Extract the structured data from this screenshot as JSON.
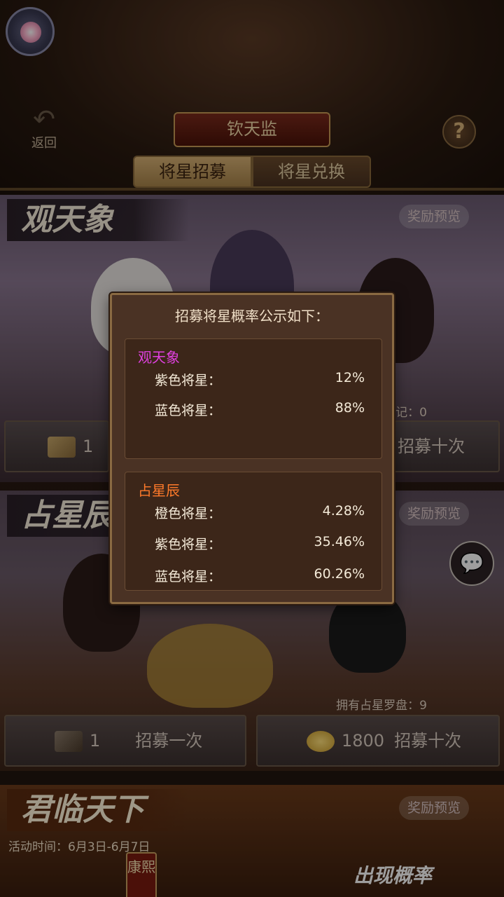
{
  "header": {
    "back_label": "返回",
    "title": "钦天监",
    "help_symbol": "?"
  },
  "tabs": [
    {
      "label": "将星招募",
      "active": true
    },
    {
      "label": "将星兑换",
      "active": false
    }
  ],
  "banners": [
    {
      "title": "观天象",
      "preview_label": "奖励预览",
      "record_note": "记：0",
      "single_cost": "1",
      "ten_label": "招募十次"
    },
    {
      "title": "占星辰",
      "preview_label": "奖励预览",
      "owned_note": "拥有占星罗盘：9",
      "single_cost": "1",
      "single_label": "招募一次",
      "ten_cost": "1800",
      "ten_label": "招募十次"
    },
    {
      "title": "君临天下",
      "preview_label": "奖励预览",
      "event_time": "活动时间：6月3日-6月7日",
      "hero_tag": "康熙",
      "prob_tag": "出现概率"
    }
  ],
  "dialog": {
    "title": "招募将星概率公示如下：",
    "groups": [
      {
        "name": "观天象",
        "color": "#e040e0",
        "rows": [
          {
            "label": "紫色将星：",
            "value": "12%"
          },
          {
            "label": "蓝色将星：",
            "value": "88%"
          }
        ]
      },
      {
        "name": "占星辰",
        "color": "#ff7a2a",
        "rows": [
          {
            "label": "橙色将星：",
            "value": "4.28%"
          },
          {
            "label": "紫色将星：",
            "value": "35.46%"
          },
          {
            "label": "蓝色将星：",
            "value": "60.26%"
          }
        ]
      }
    ]
  },
  "icons": {
    "settings": "gear-icon",
    "back": "back-arrow-icon",
    "help": "question-icon",
    "chat": "chat-bubble-icon"
  }
}
